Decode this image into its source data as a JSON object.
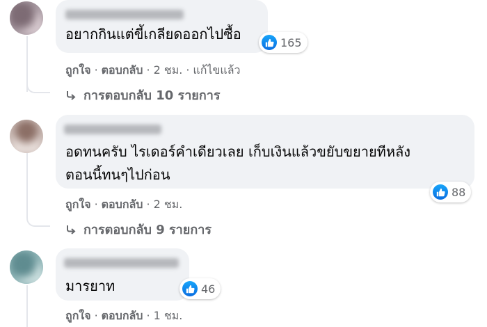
{
  "comments": [
    {
      "text_lines": [
        "อยากกินแต่ขี้เกลียดออกไปซื้อ"
      ],
      "like_count": "165",
      "actions": {
        "like": "ถูกใจ",
        "reply": "ตอบกลับ",
        "time": "2 ชม.",
        "edited": "แก้ไขแล้ว"
      },
      "replies": "การตอบกลับ 10 รายการ"
    },
    {
      "text_lines": [
        "อดทนครับ ไรเดอร์คำเดียวเลย เก็บเงินแล้วขยับขยายทีหลัง",
        "ตอนนี้ทนๆไปก่อน"
      ],
      "like_count": "88",
      "actions": {
        "like": "ถูกใจ",
        "reply": "ตอบกลับ",
        "time": "2 ชม."
      },
      "replies": "การตอบกลับ 9 รายการ"
    },
    {
      "text_lines": [
        "มารยาท"
      ],
      "like_count": "46",
      "actions": {
        "like": "ถูกใจ",
        "reply": "ตอบกลับ",
        "time": "1 ชม."
      }
    }
  ],
  "colors": {
    "bubble": "#f0f2f5",
    "like_blue": "#1877f2",
    "meta_gray": "#65676b"
  }
}
